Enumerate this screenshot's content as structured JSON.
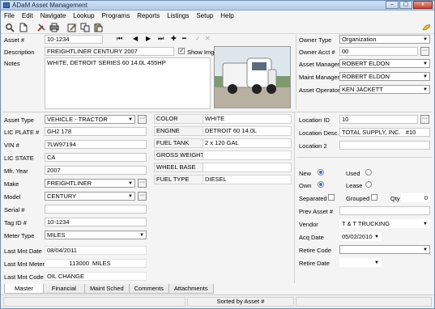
{
  "window": {
    "title": "ADaM Asset Management",
    "minimize": "–",
    "maximize": "▢",
    "close": "x"
  },
  "menu": [
    "File",
    "Edit",
    "Navigate",
    "Lookup",
    "Programs",
    "Reports",
    "Listings",
    "Setup",
    "Help"
  ],
  "toolbar_icons": [
    "zoom-icon",
    "new-document-icon",
    "tools-icon",
    "print-icon",
    "edit-icon",
    "copy-icon",
    "paste-icon",
    "help-icon"
  ],
  "nav": {
    "first": "⏮",
    "prev": "◀",
    "next": "▶",
    "last": "⏭",
    "add": "✚",
    "delete": "━",
    "post": "✓",
    "cancel": "✕"
  },
  "header": {
    "asset_label": "Asset #",
    "asset_value": "10-1234",
    "description_label": "Description",
    "description_value": "FREIGHTLINER CENTURY 2007",
    "show_img_label": "Show Img",
    "show_img_checked": true,
    "notes_label": "Notes",
    "notes_value": "WHITE, DETROIT SERIES 60 14.0L 455HP"
  },
  "owner": {
    "owner_type_label": "Owner Type",
    "owner_type_value": "Organization",
    "owner_acct_label": "Owner Acct #",
    "owner_acct_value": "00",
    "asset_manager_label": "Asset Manager",
    "asset_manager_value": "ROBERT ELDON",
    "maint_manager_label": "Maint Manager",
    "maint_manager_value": "ROBERT ELDON",
    "asset_operator_label": "Asset Operator",
    "asset_operator_value": "KEN JACKETT"
  },
  "left": {
    "asset_type_label": "Asset Type",
    "asset_type_value": "VEHICLE - TRACTOR",
    "lic_plate_label": "LIC PLATE #",
    "lic_plate_value": "GH2 178",
    "vin_label": "VIN #",
    "vin_value": "7LW97194",
    "lic_state_label": "LIC STATE",
    "lic_state_value": "CA",
    "mfr_year_label": "Mfr. Year",
    "mfr_year_value": "2007",
    "make_label": "Make",
    "make_value": "FREIGHTLINER",
    "model_label": "Model",
    "model_value": "CENTURY",
    "serial_label": "Serial #",
    "serial_value": "",
    "tag_label": "Tag ID #",
    "tag_value": "10-1234",
    "meter_type_label": "Meter Type",
    "meter_type_value": "MILES",
    "last_mnt_date_label": "Last Mnt Date",
    "last_mnt_date_value": "08/04/2011",
    "last_mnt_meter_label": "Last Mnt Meter",
    "last_mnt_meter_value": "113000",
    "last_mnt_meter_unit": "MILES",
    "last_mnt_code_label": "Last Mnt Code",
    "last_mnt_code_value": "OIL CHANGE"
  },
  "specs": [
    {
      "label": "COLOR",
      "value": "WHITE"
    },
    {
      "label": "ENGINE",
      "value": "DETROIT 60 14.0L"
    },
    {
      "label": "FUEL TANK",
      "value": "2 x 120 GAL"
    },
    {
      "label": "GROSS WEIGHT",
      "value": ""
    },
    {
      "label": "WHEEL BASE",
      "value": ""
    },
    {
      "label": "FUEL TYPE",
      "value": "DIESEL"
    }
  ],
  "right": {
    "location_id_label": "Location ID",
    "location_id_value": "10",
    "location_desc_label": "Location Desc.",
    "location_desc_value": "TOTAL SUPPLY, INC.   #10",
    "location2_label": "Location 2",
    "location2_value": "",
    "new_label": "New",
    "used_label": "Used",
    "own_label": "Own",
    "lease_label": "Lease",
    "separated_label": "Separated",
    "grouped_label": "Grouped",
    "qty_label": "Qty",
    "qty_value": "0",
    "prev_asset_label": "Prev Asset #",
    "prev_asset_value": "",
    "vendor_label": "Vendor",
    "vendor_value": "T & T TRUCKING",
    "acq_date_label": "Acq Date",
    "acq_date_value": "05/02/2010",
    "retire_code_label": "Retire Code",
    "retire_code_value": "",
    "retire_date_label": "Retire Date",
    "retire_date_value": ""
  },
  "tabs": [
    "Master",
    "Financial",
    "Maint Sched",
    "Comments",
    "Attachments"
  ],
  "status": {
    "sorted": "Sorted by Asset #"
  }
}
